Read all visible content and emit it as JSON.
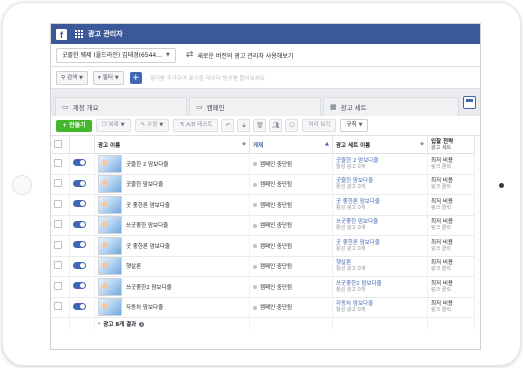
{
  "app": {
    "title": "광고 관리자",
    "logo_letter": "f"
  },
  "account": {
    "selected": "굿즐한 웨제 (올드라인) 김태경(6544...",
    "new_version_link": "새로운 버전의 광고 관리자 사용해보기"
  },
  "filters": {
    "search_label": "검색",
    "filter_label": "필터",
    "add_label": "+",
    "hint": "필터를 추가하여 표시할 데이터 범위를 좁혀보세요"
  },
  "tabs": [
    {
      "label": "계정 개요"
    },
    {
      "label": "캠페인"
    },
    {
      "label": "광고 세트"
    }
  ],
  "toolbar": {
    "create_label": "+ 만들기",
    "duplicate_label": "복제",
    "edit_label": "수정",
    "ab_test_label": "A/B 테스트",
    "preview_label": "미리 보기",
    "rules_label": "규칙"
  },
  "table": {
    "headers": {
      "name": "광고 이름",
      "delivery": "게재",
      "adset": "광고 세트 이름",
      "bid": "입찰 전략",
      "bid_sub": "광고 세트"
    },
    "rows": [
      {
        "name": "굿즐한 2 맘보다줄",
        "delivery": "캠페인 중단됨",
        "adset": "굿즐한 2 맘보다줄",
        "adset_sub": "활성 광고 0개",
        "bid": "최저 비용",
        "bid_sub": "링크 클릭"
      },
      {
        "name": "굿즐한 맘보다줄",
        "delivery": "캠페인 중단됨",
        "adset": "굿즐한 맘보다줄",
        "adset_sub": "활성 광고 0개",
        "bid": "최저 비용",
        "bid_sub": "링크 클릭"
      },
      {
        "name": "굿 좋한론 맘보다줄",
        "delivery": "캠페인 중단됨",
        "adset": "굿 좋한론 맘보다줄",
        "adset_sub": "활성 광고 0개",
        "bid": "최저 비용",
        "bid_sub": "링크 클릭"
      },
      {
        "name": "쓰굿좋한 맘보다줄",
        "delivery": "캠페인 중단됨",
        "adset": "쓰굿좋한 맘보다줄",
        "adset_sub": "활성 광고 0개",
        "bid": "최저 비용",
        "bid_sub": "링크 클릭"
      },
      {
        "name": "굿 좋한론 맘보다줄",
        "delivery": "캠페인 중단됨",
        "adset": "굿 좋한론 맘보다줄",
        "adset_sub": "활성 광고 0개",
        "bid": "최저 비용",
        "bid_sub": "링크 클릭"
      },
      {
        "name": "햇살론",
        "delivery": "캠페인 중단됨",
        "adset": "햇살론",
        "adset_sub": "활성 광고 0개",
        "bid": "최저 비용",
        "bid_sub": "링크 클릭"
      },
      {
        "name": "쓰굿좋한2 맘보다줄",
        "delivery": "캠페인 중단됨",
        "adset": "쓰굿좋한2 맘보다줄",
        "adset_sub": "활성 광고 0개",
        "bid": "최저 비용",
        "bid_sub": "링크 클릭"
      },
      {
        "name": "자동차 맘보다줄",
        "delivery": "캠페인 중단됨",
        "adset": "자동차 맘보다줄",
        "adset_sub": "활성 광고 0개",
        "bid": "최저 비용",
        "bid_sub": "링크 클릭"
      }
    ],
    "summary": "광고 8개 결과"
  },
  "colors": {
    "brand": "#3b5998",
    "create": "#42b72a",
    "link": "#4267b2"
  }
}
